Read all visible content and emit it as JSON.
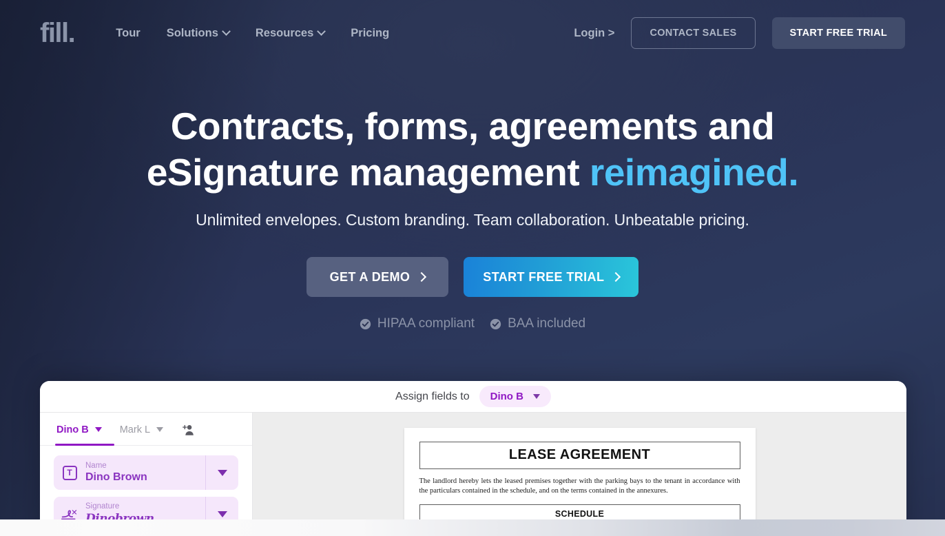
{
  "theme": {
    "bg_dark": "#2a3352",
    "accent_cyan": "#4fc3f7",
    "brand_purple": "#9018c4",
    "cta_gradient_from": "#1a82d8",
    "cta_gradient_to": "#2ac6da"
  },
  "nav": {
    "logo": "fill.",
    "links": [
      {
        "label": "Tour",
        "has_chevron": false
      },
      {
        "label": "Solutions",
        "has_chevron": true
      },
      {
        "label": "Resources",
        "has_chevron": true
      },
      {
        "label": "Pricing",
        "has_chevron": false
      }
    ],
    "login_label": "Login >",
    "contact_sales_label": "CONTACT SALES",
    "start_trial_label": "START FREE TRIAL"
  },
  "hero": {
    "headline_line1": "Contracts, forms, agreements and",
    "headline_line2_main": "eSignature management ",
    "headline_line2_accent": "reimagined.",
    "subhead": "Unlimited envelopes. Custom branding. Team collaboration. Unbeatable pricing.",
    "cta_demo": "GET A DEMO",
    "cta_trial": "START FREE TRIAL",
    "badges": [
      {
        "icon": "check-circle-icon",
        "label": "HIPAA compliant"
      },
      {
        "icon": "check-circle-icon",
        "label": "BAA included"
      }
    ]
  },
  "app": {
    "topbar": {
      "assign_label": "Assign fields to",
      "assignee": "Dino B"
    },
    "sidebar": {
      "tabs": [
        {
          "label": "Dino B",
          "active": true
        },
        {
          "label": "Mark L",
          "active": false
        }
      ],
      "add_person_icon": "add-person-icon",
      "fields": [
        {
          "icon": "text-field-icon",
          "label": "Name",
          "value": "Dino Brown",
          "style": "normal"
        },
        {
          "icon": "signature-icon",
          "label": "Signature",
          "value": "Dinobrown",
          "style": "script"
        }
      ]
    },
    "document": {
      "title": "LEASE AGREEMENT",
      "paragraph": "The landlord hereby lets the leased premises together with the parking bays to the tenant in accordance with the particulars contained in the schedule, and on the terms contained in the annexures.",
      "schedule_heading": "SCHEDULE"
    }
  }
}
